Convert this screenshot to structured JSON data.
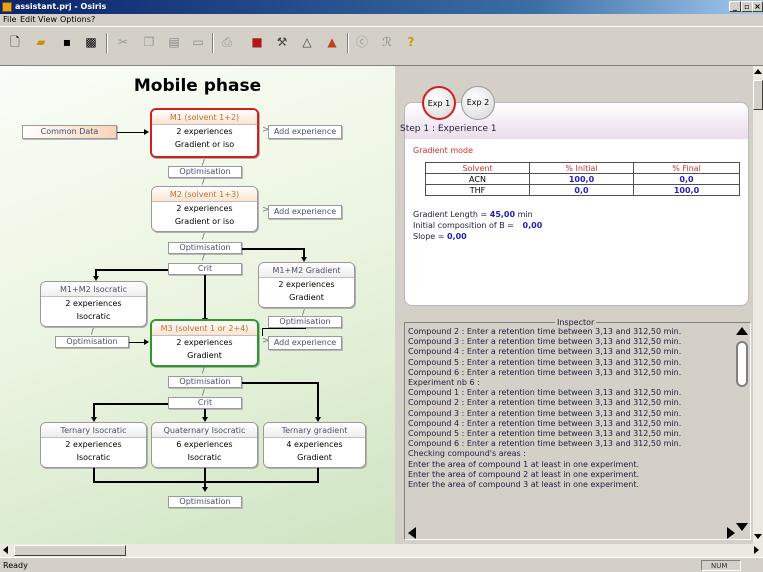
{
  "window": {
    "title": "assistant.prj - Osiris"
  },
  "menu": [
    "File",
    "Edit",
    "View",
    "Options",
    "?"
  ],
  "toolbar_icons": [
    "new-file-icon",
    "open-folder-icon",
    "save-icon",
    "save-as-icon",
    "cut-icon",
    "copy-icon",
    "paste-icon",
    "window-icon",
    "print-icon",
    "book-icon",
    "tools-icon",
    "triangle-icon",
    "warning-icon",
    "chart-icon",
    "chart-alt-icon",
    "help-icon"
  ],
  "flow": {
    "title": "Mobile phase",
    "common_data": "Common Data",
    "add_experience": "Add experience",
    "optimisation": "Optimisation",
    "crit": "Crit",
    "m1": {
      "head": "M1 (solvent 1+2)",
      "l1": "2 experiences",
      "l2": "Gradient or iso"
    },
    "m2": {
      "head": "M2 (solvent 1+3)",
      "l1": "2 experiences",
      "l2": "Gradient or iso"
    },
    "m3": {
      "head": "M3 (solvent 1 or 2+4)",
      "l1": "2 experiences",
      "l2": "Gradient"
    },
    "m12_iso": {
      "head": "M1+M2 Isocratic",
      "l1": "2 experiences",
      "l2": "Isocratic"
    },
    "m12_grad": {
      "head": "M1+M2 Gradient",
      "l1": "2 experiences",
      "l2": "Gradient"
    },
    "ternary_iso": {
      "head": "Ternary Isocratic",
      "l1": "2 experiences",
      "l2": "Isocratic"
    },
    "quaternary_iso": {
      "head": "Quaternary Isocratic",
      "l1": "6 experiences",
      "l2": "Isocratic"
    },
    "ternary_grad": {
      "head": "Ternary gradient",
      "l1": "4 experiences",
      "l2": "Gradient"
    },
    "tick": "/",
    "gt": ">"
  },
  "experiment": {
    "tabs": [
      "Exp 1",
      "Exp 2"
    ],
    "active_tab": "Exp 1",
    "step": "Step 1 : Experience 1",
    "mode": "Gradient mode",
    "table": {
      "headers": [
        "Solvent",
        "% Initial",
        "% Final"
      ],
      "rows": [
        [
          "ACN",
          "100,0",
          "0,0"
        ],
        [
          "THF",
          "0,0",
          "100,0"
        ]
      ]
    },
    "gradient_length_label": "Gradient Length =",
    "gradient_length_value": "45,00",
    "gradient_length_unit": "min",
    "initial_b_label": "Initial composition of B =",
    "initial_b_value": "0,00",
    "slope_label": "Slope =",
    "slope_value": "0,00"
  },
  "inspector": {
    "title": "Inspector",
    "lines": [
      "Compound 2 : Enter a retention time between 3,13 and 312,50 min.",
      "Compound 3 : Enter a retention time between 3,13 and 312,50 min.",
      "Compound 4 : Enter a retention time between 3,13 and 312,50 min.",
      "Compound 5 : Enter a retention time between 3,13 and 312,50 min.",
      "Compound 6 : Enter a retention time between 3,13 and 312,50 min.",
      "Experiment nb 6 :",
      "Compound 1 : Enter a retention time between 3,13 and 312,50 min.",
      "Compound 2 : Enter a retention time between 3,13 and 312,50 min.",
      "Compound 3 : Enter a retention time between 3,13 and 312,50 min.",
      "Compound 4 : Enter a retention time between 3,13 and 312,50 min.",
      "Compound 5 : Enter a retention time between 3,13 and 312,50 min.",
      "Compound 6 : Enter a retention time between 3,13 and 312,50 min.",
      "Checking compound's areas :",
      "Enter the area of compound 1 at least in one experiment.",
      "Enter the area of compound 2 at least in one experiment.",
      "Enter the area of compound 3 at least in one experiment."
    ]
  },
  "status": {
    "text": "Ready",
    "num": "NUM"
  },
  "colors": {
    "titlebar": "#0a246a",
    "active_red": "#d02020",
    "active_green": "#2a9a2a",
    "value_blue": "#2020c0"
  }
}
